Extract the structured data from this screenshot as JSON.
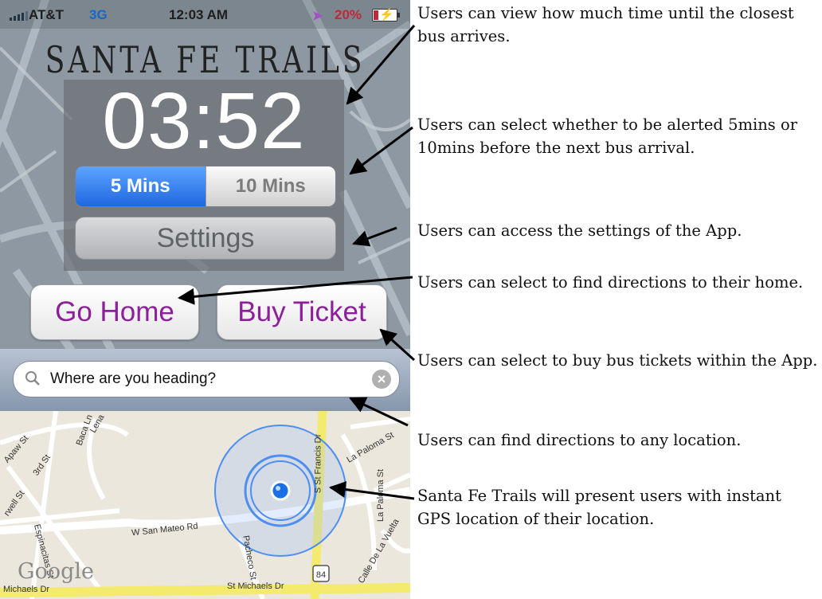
{
  "status_bar": {
    "carrier": "AT&T",
    "network": "3G",
    "time": "12:03 AM",
    "battery_percent": "20%",
    "icons": [
      "signal-bars-icon",
      "location-arrow-icon",
      "battery-charging-icon"
    ]
  },
  "app": {
    "logo_text": "SANTA FE TRAILS",
    "countdown": "03:52",
    "alert_options": [
      "5 Mins",
      "10 Mins"
    ],
    "alert_selected": "5 Mins",
    "settings_label": "Settings",
    "go_home_label": "Go Home",
    "buy_ticket_label": "Buy Ticket",
    "search_placeholder": "Where are you heading?",
    "accent_color": "#8c1f9a",
    "segment_selected_color": "#1f67e0"
  },
  "map": {
    "streets": [
      "Baca Ln",
      "Lena",
      "Apaw St",
      "3rd St",
      "rwell St",
      "Espinacitas St",
      "W San Mateo Rd",
      "Pacheco St",
      "S St Francis Dr",
      "La Paloma St",
      "Calle De La Vuelta",
      "St Michaels Dr",
      "Michaels Dr",
      "La Paloma St"
    ],
    "route_marker": "84",
    "attribution": "Google"
  },
  "annotations": [
    "Users can view how much time until the closest bus arrives.",
    "Users can select whether to be alerted 5mins or 10mins before the next bus arrival.",
    "Users can access the settings of the App.",
    "Users can select to find directions to their home.",
    "Users can select to buy bus tickets within the App.",
    "Users can find directions to any location.",
    "Santa Fe Trails will present users with instant GPS location of their location."
  ]
}
